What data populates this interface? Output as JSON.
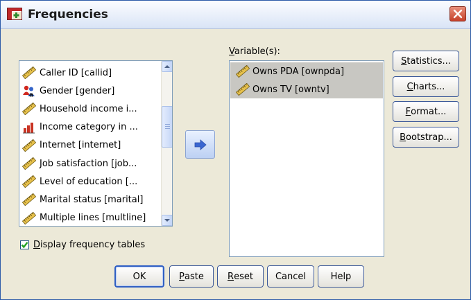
{
  "window": {
    "title": "Frequencies",
    "close_glyph": "✕"
  },
  "source_list": {
    "items": [
      {
        "label": "Caller ID [callid]",
        "icon": "scale-ruler-icon"
      },
      {
        "label": "Gender [gender]",
        "icon": "nominal-people-icon"
      },
      {
        "label": "Household income i...",
        "icon": "scale-ruler-icon"
      },
      {
        "label": "Income category in ...",
        "icon": "ordinal-bars-icon"
      },
      {
        "label": "Internet [internet]",
        "icon": "scale-ruler-icon"
      },
      {
        "label": "Job satisfaction [job...",
        "icon": "scale-ruler-icon"
      },
      {
        "label": "Level of education [...",
        "icon": "scale-ruler-icon"
      },
      {
        "label": "Marital status [marital]",
        "icon": "scale-ruler-icon"
      },
      {
        "label": "Multiple lines [multline]",
        "icon": "scale-ruler-icon"
      }
    ]
  },
  "move_button": {
    "icon": "right-arrow-icon"
  },
  "target": {
    "label_accel": "V",
    "label_rest": "ariable(s):",
    "items": [
      {
        "label": "Owns PDA [ownpda]",
        "icon": "scale-ruler-icon"
      },
      {
        "label": "Owns TV [owntv]",
        "icon": "scale-ruler-icon"
      }
    ]
  },
  "side_buttons": [
    {
      "accel": "S",
      "rest": "tatistics..."
    },
    {
      "accel": "C",
      "rest": "harts..."
    },
    {
      "accel": "F",
      "rest": "ormat..."
    },
    {
      "accel": "B",
      "rest": "ootstrap..."
    }
  ],
  "display_tables": {
    "checked": true,
    "accel": "D",
    "rest": "isplay frequency tables"
  },
  "bottom_buttons": [
    {
      "label": "OK",
      "accel": "",
      "rest": "OK"
    },
    {
      "label": "Paste",
      "accel": "P",
      "rest": "aste"
    },
    {
      "label": "Reset",
      "accel": "R",
      "rest": "eset"
    },
    {
      "label": "Cancel",
      "accel": "",
      "rest": "Cancel"
    },
    {
      "label": "Help",
      "accel": "",
      "rest": "Help"
    }
  ],
  "colors": {
    "title_bar": "#dfe8f7",
    "dialog_face": "#ece9d8",
    "selection": "#c8c7c2",
    "close_button": "#c5402a",
    "arrow": "#3a66d1"
  }
}
